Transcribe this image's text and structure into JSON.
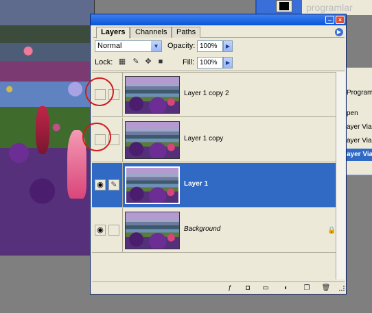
{
  "palette": {
    "tabs": [
      "Layers",
      "Channels",
      "Paths"
    ],
    "active_tab": "Layers",
    "blend_mode": "Normal",
    "opacity_label": "Opacity:",
    "opacity_value": "100%",
    "lock_label": "Lock:",
    "fill_label": "Fill:",
    "fill_value": "100%",
    "layers": [
      {
        "name": "Layer 1 copy 2",
        "visible": false,
        "selected": false,
        "locked": false
      },
      {
        "name": "Layer 1 copy",
        "visible": false,
        "selected": false,
        "locked": false
      },
      {
        "name": "Layer 1",
        "visible": true,
        "selected": true,
        "locked": false
      },
      {
        "name": "Background",
        "visible": true,
        "selected": false,
        "locked": true
      }
    ]
  },
  "right_panel": {
    "items": [
      "Programl",
      "pen",
      "ayer Via C",
      "ayer Via C",
      "ayer Via"
    ]
  },
  "colors": {
    "title_bar": "#0a54d8",
    "selection": "#316ac5",
    "annotation_circle": "#d21a1a",
    "panel_bg": "#ece9d8"
  }
}
